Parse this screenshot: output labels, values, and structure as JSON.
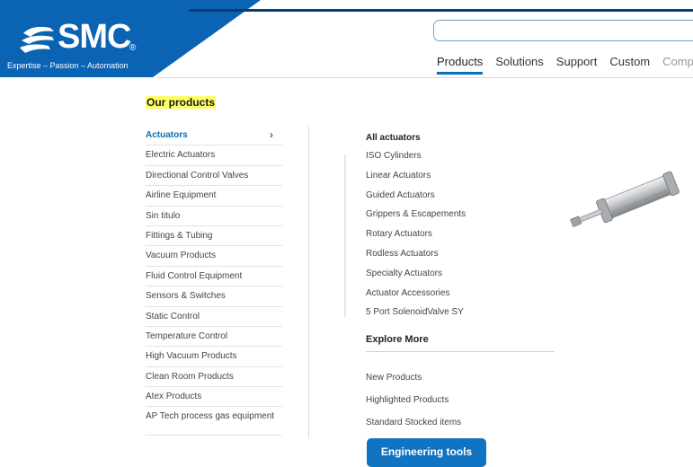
{
  "header": {
    "brand": "SMC",
    "brand_reg": "®",
    "tagline": "Expertise – Passion – Automation",
    "colors": {
      "brand_blue": "#0b63b3",
      "accent": "#0074be"
    },
    "search": {
      "value": "",
      "placeholder": ""
    },
    "nav": [
      {
        "label": "Products",
        "active": true
      },
      {
        "label": "Solutions"
      },
      {
        "label": "Support"
      },
      {
        "label": "Custom"
      },
      {
        "label": "Comp"
      }
    ]
  },
  "page": {
    "title": "Our products"
  },
  "categories": [
    {
      "label": "Actuators",
      "active": true,
      "icon": "chevron-right-icon"
    },
    {
      "label": "Electric Actuators"
    },
    {
      "label": "Directional Control Valves"
    },
    {
      "label": "Airline Equipment"
    },
    {
      "label": "Sin titulo"
    },
    {
      "label": "Fittings & Tubing"
    },
    {
      "label": "Vacuum Products"
    },
    {
      "label": "Fluid Control Equipment"
    },
    {
      "label": "Sensors & Switches"
    },
    {
      "label": "Static Control"
    },
    {
      "label": "Temperature Control"
    },
    {
      "label": "High Vacuum Products"
    },
    {
      "label": "Clean Room Products"
    },
    {
      "label": "Atex Products"
    },
    {
      "label": "AP Tech process gas equipment"
    }
  ],
  "subcategories": {
    "heading": "All actuators",
    "items": [
      "ISO Cylinders",
      "Linear Actuators",
      "Guided Actuators",
      "Grippers & Escapements",
      "Rotary Actuators",
      "Rodless Actuators",
      "Specialty Actuators",
      "Actuator Accessories",
      "5 Port SolenoidValve SY"
    ]
  },
  "explore": {
    "heading": "Explore More",
    "items": [
      "New Products",
      "Highlighted Products",
      "Standard Stocked items"
    ],
    "button": "Engineering tools"
  }
}
